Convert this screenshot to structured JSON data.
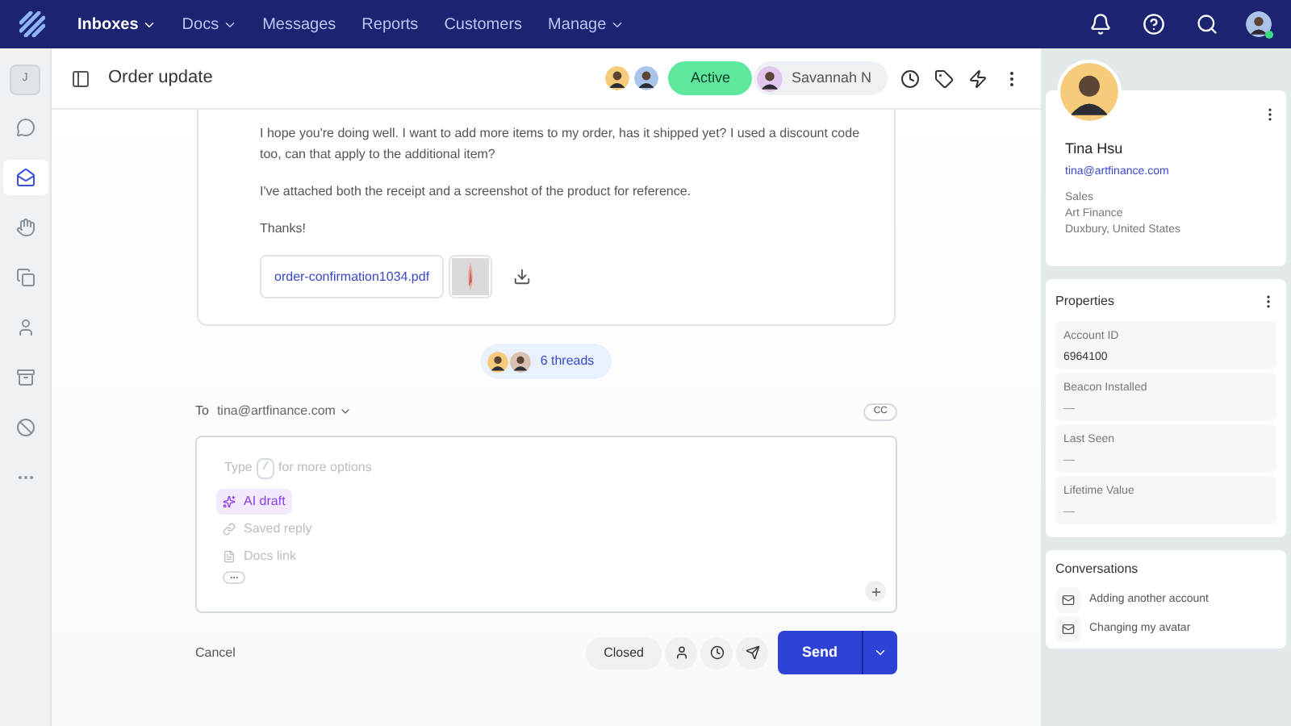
{
  "nav": {
    "items": [
      {
        "label": "Inboxes",
        "dropdown": true,
        "selected": true
      },
      {
        "label": "Docs",
        "dropdown": true,
        "selected": false
      },
      {
        "label": "Messages",
        "dropdown": false,
        "selected": false
      },
      {
        "label": "Reports",
        "dropdown": false,
        "selected": false
      },
      {
        "label": "Customers",
        "dropdown": false,
        "selected": false
      },
      {
        "label": "Manage",
        "dropdown": true,
        "selected": false
      }
    ],
    "user_online": true
  },
  "rail": {
    "badge": "J",
    "items": [
      {
        "kind": "chat",
        "selected": false
      },
      {
        "kind": "inbox",
        "selected": true
      },
      {
        "kind": "hand",
        "selected": false
      },
      {
        "kind": "pages",
        "selected": false
      },
      {
        "kind": "person",
        "selected": false
      },
      {
        "kind": "archive",
        "selected": false
      },
      {
        "kind": "blocked",
        "selected": false
      },
      {
        "kind": "more",
        "selected": false
      }
    ]
  },
  "header": {
    "title": "Order update",
    "status": "Active",
    "assignee": "Savannah N"
  },
  "message": {
    "paragraphs": [
      "I hope you're doing well. I want to add more items to my order, has it shipped yet? I used a discount code too, can that apply to the additional item?",
      "I've attached both the receipt and a screenshot of the product for reference.",
      "Thanks!"
    ],
    "attachment": "order-confirmation1034.pdf"
  },
  "threads": "6 threads",
  "compose": {
    "to_label": "To",
    "to": "tina@artfinance.com",
    "cc": "CC",
    "hint_before": "Type",
    "hint_key": "/",
    "hint_after": "for more options",
    "options": [
      {
        "kind": "ai",
        "label": "AI draft",
        "highlighted": true
      },
      {
        "kind": "saved",
        "label": "Saved reply",
        "highlighted": false
      },
      {
        "kind": "docs",
        "label": "Docs link",
        "highlighted": false
      }
    ]
  },
  "footer": {
    "cancel": "Cancel",
    "status": "Closed",
    "send": "Send"
  },
  "customer": {
    "name": "Tina Hsu",
    "email": "tina@artfinance.com",
    "details": [
      "Sales",
      "Art Finance",
      "Duxbury, United States"
    ]
  },
  "properties": {
    "title": "Properties",
    "items": [
      {
        "label": "Account ID",
        "value": "6964100"
      },
      {
        "label": "Beacon Installed",
        "value": "—"
      },
      {
        "label": "Last Seen",
        "value": "—"
      },
      {
        "label": "Lifetime Value",
        "value": "—"
      }
    ]
  },
  "conversations": {
    "title": "Conversations",
    "items": [
      "Adding another account",
      "Changing my avatar"
    ]
  }
}
